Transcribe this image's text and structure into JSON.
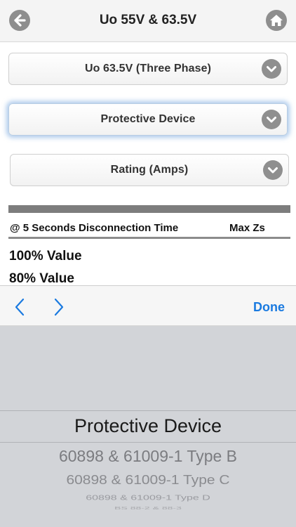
{
  "header": {
    "title": "Uo 55V & 63.5V",
    "back_icon": "back-arrow-icon",
    "home_icon": "home-icon"
  },
  "selects": {
    "voltage": "Uo 63.5V (Three Phase)",
    "device": "Protective Device",
    "rating": "Rating (Amps)",
    "chevron_icon": "chevron-down-icon"
  },
  "table": {
    "col_left": "@ 5 Seconds Disconnection Time",
    "col_right": "Max Zs",
    "row1": "100% Value",
    "row2": "80% Value"
  },
  "toolbar": {
    "prev_icon": "chevron-left-icon",
    "next_icon": "chevron-right-icon",
    "done_label": "Done"
  },
  "picker": {
    "selected": "Protective Device",
    "items": [
      "60898 & 61009-1 Type B",
      "60898 & 61009-1 Type C",
      "60898 & 61009-1 Type D",
      "BS 88-2 & 88-3"
    ]
  },
  "colors": {
    "accent": "#1a7ae0",
    "icon_gray": "#8e8e8e",
    "focus_glow": "#6ea0dc",
    "picker_bg": "#d2d4d8"
  }
}
